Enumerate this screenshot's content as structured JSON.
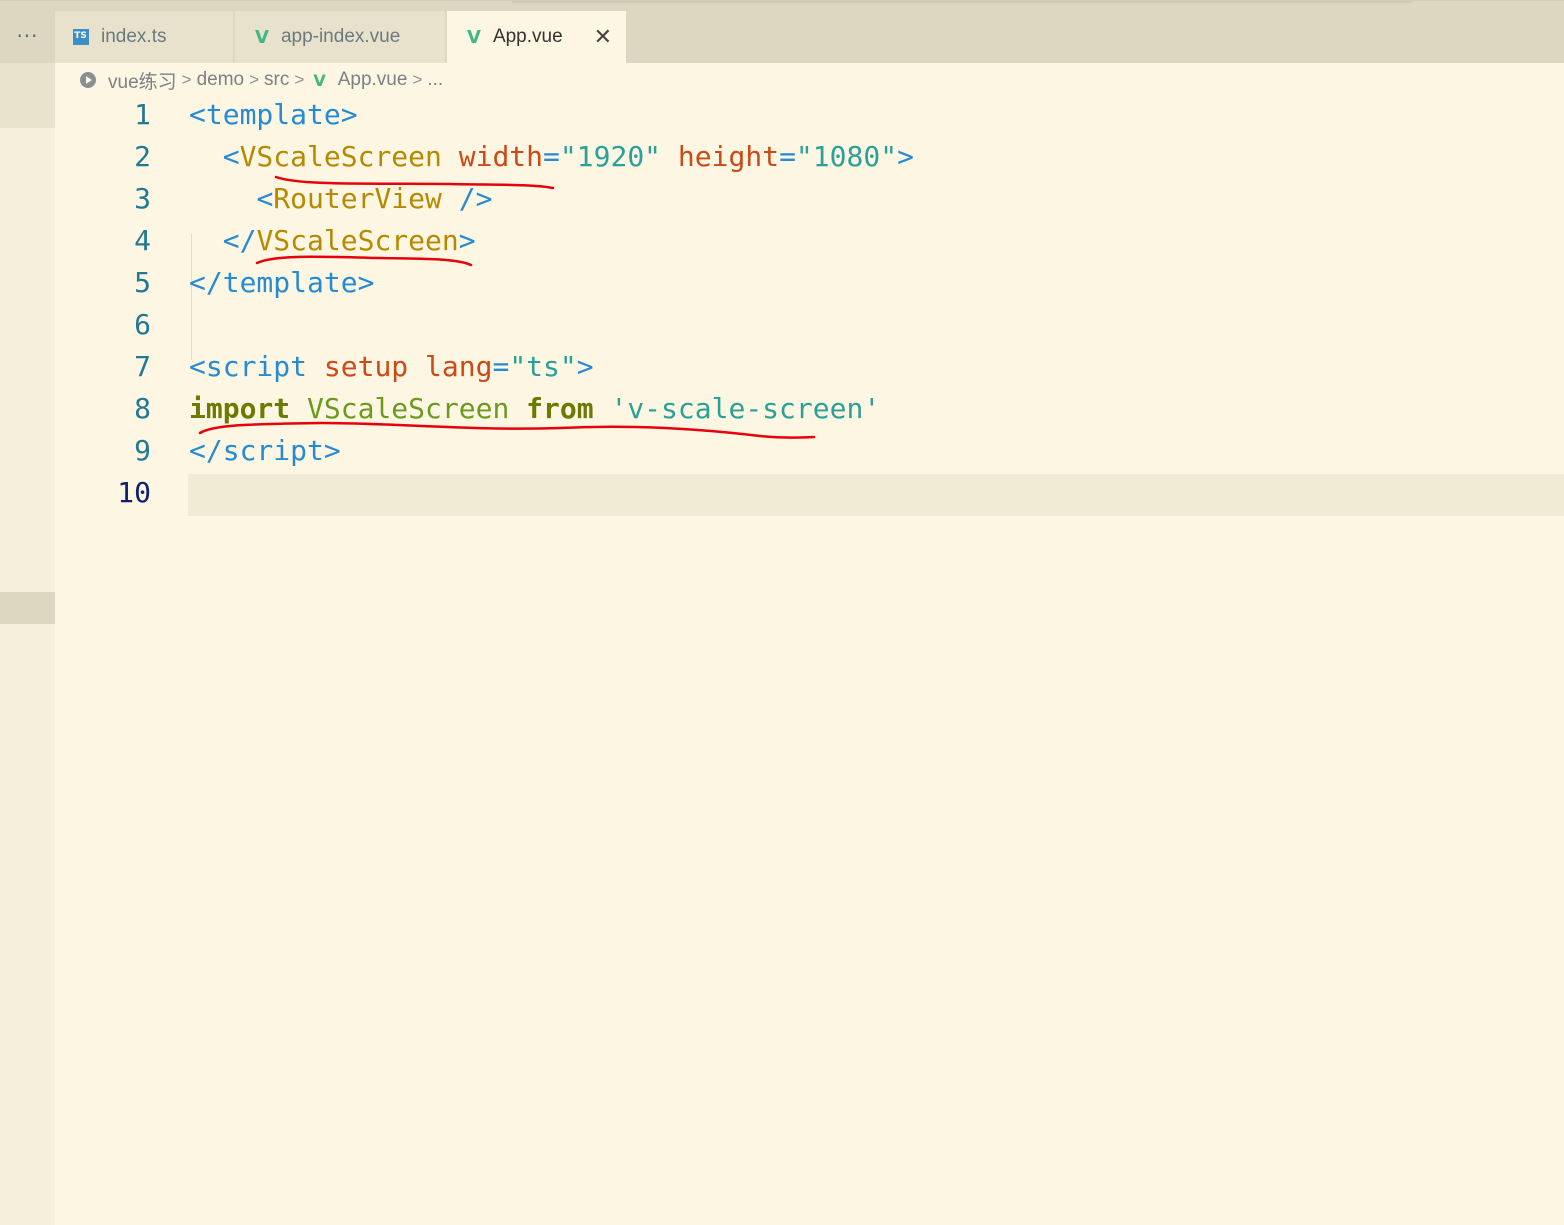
{
  "tabs": {
    "more_label": "···",
    "items": [
      {
        "label": "index.ts",
        "icon": "ts-file-icon",
        "icon_text": "TS"
      },
      {
        "label": "app-index.vue",
        "icon": "vue-file-icon",
        "icon_text": "V"
      },
      {
        "label": "App.vue",
        "icon": "vue-file-icon",
        "icon_text": "V",
        "active": true,
        "close": "✕"
      }
    ]
  },
  "breadcrumb": {
    "items": [
      "vue练习",
      "demo",
      "src",
      "App.vue",
      "..."
    ],
    "separator": ">",
    "vue_icon_text": "V"
  },
  "editor": {
    "current_line": 10,
    "lines": [
      {
        "n": "1"
      },
      {
        "n": "2"
      },
      {
        "n": "3"
      },
      {
        "n": "4"
      },
      {
        "n": "5"
      },
      {
        "n": "6"
      },
      {
        "n": "7"
      },
      {
        "n": "8"
      },
      {
        "n": "9"
      },
      {
        "n": "10"
      }
    ],
    "code": {
      "l1": {
        "open": "<",
        "tag": "template",
        "close": ">"
      },
      "l2": {
        "open": "<",
        "tag": "VScaleScreen",
        "attr1": "width",
        "eq1": "=",
        "val1": "\"1920\"",
        "attr2": "height",
        "eq2": "=",
        "val2": "\"1080\"",
        "close": ">"
      },
      "l3": {
        "open": "<",
        "tag": "RouterView",
        "close": "/>"
      },
      "l4": {
        "open": "</",
        "tag": "VScaleScreen",
        "close": ">"
      },
      "l5": {
        "open": "</",
        "tag": "template",
        "close": ">"
      },
      "l7": {
        "open": "<",
        "tag": "script",
        "attr1": "setup",
        "attr2": "lang",
        "eq": "=",
        "val": "\"ts\"",
        "close": ">"
      },
      "l8": {
        "kw1": "import",
        "ident": "VScaleScreen",
        "kw2": "from",
        "str": "'v-scale-screen'"
      },
      "l9": {
        "open": "</",
        "tag": "script",
        "close": ">"
      }
    }
  },
  "colors": {
    "background": "#fdf6e3",
    "tag_punct": "#268bd2",
    "component": "#b58900",
    "attribute": "#cb4b16",
    "string": "#2aa198",
    "keyword": "#859900",
    "annotation_ink": "#e8000b"
  }
}
